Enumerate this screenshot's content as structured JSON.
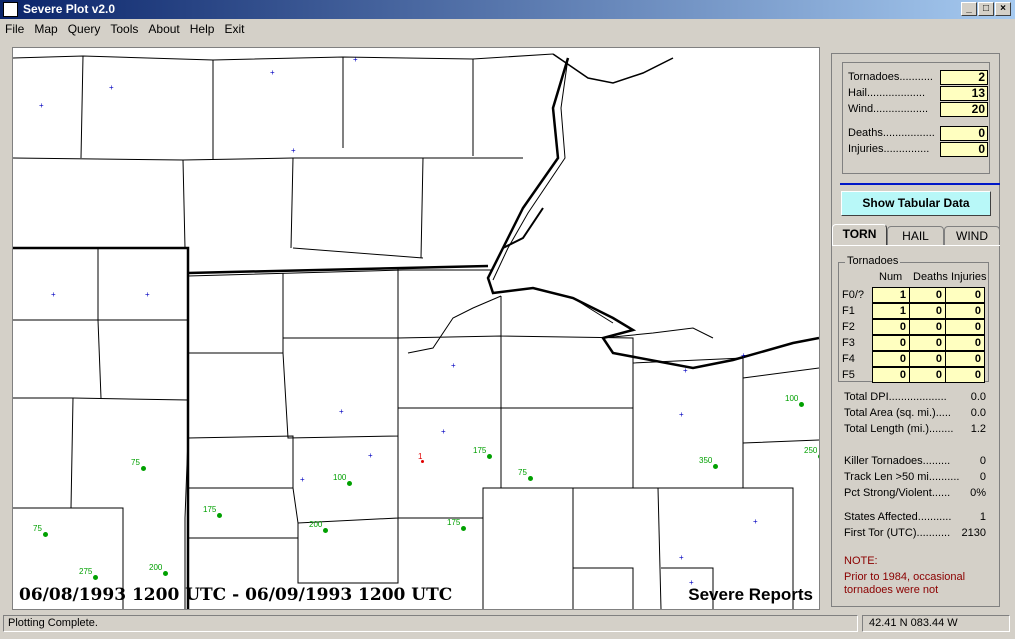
{
  "window": {
    "title": "Severe Plot v2.0"
  },
  "menu": [
    "File",
    "Map",
    "Query",
    "Tools",
    "About",
    "Help",
    "Exit"
  ],
  "map": {
    "date_range": "06/08/1993 1200 UTC - 06/09/1993 1200 UTC",
    "overlay_title": "Severe Reports",
    "reports": [
      {
        "label": "75"
      },
      {
        "label": "100"
      },
      {
        "label": "175"
      },
      {
        "label": "200"
      },
      {
        "label": "75"
      },
      {
        "label": "275"
      },
      {
        "label": "200"
      },
      {
        "label": "175"
      },
      {
        "label": "75"
      },
      {
        "label": "175"
      },
      {
        "label": "350"
      },
      {
        "label": "100"
      },
      {
        "label": "250"
      },
      {
        "label": "1"
      }
    ]
  },
  "summary": {
    "tornadoes_label": "Tornadoes...........",
    "tornadoes": "2",
    "hail_label": "Hail...................",
    "hail": "13",
    "wind_label": "Wind..................",
    "wind": "20",
    "deaths_label": "Deaths.................",
    "deaths": "0",
    "injuries_label": "Injuries...............",
    "injuries": "0"
  },
  "show_tabular_button": "Show Tabular Data",
  "tabs": [
    "TORN",
    "HAIL",
    "WIND"
  ],
  "tornadoes": {
    "group_label": "Tornadoes",
    "headers": [
      "Num",
      "Deaths",
      "Injuries"
    ],
    "rows": [
      {
        "label": "F0/?",
        "num": "1",
        "deaths": "0",
        "injuries": "0"
      },
      {
        "label": "F1",
        "num": "1",
        "deaths": "0",
        "injuries": "0"
      },
      {
        "label": "F2",
        "num": "0",
        "deaths": "0",
        "injuries": "0"
      },
      {
        "label": "F3",
        "num": "0",
        "deaths": "0",
        "injuries": "0"
      },
      {
        "label": "F4",
        "num": "0",
        "deaths": "0",
        "injuries": "0"
      },
      {
        "label": "F5",
        "num": "0",
        "deaths": "0",
        "injuries": "0"
      }
    ]
  },
  "stats": [
    {
      "label": "Total DPI...................",
      "value": "0.0"
    },
    {
      "label": "Total Area (sq. mi.).....",
      "value": "0.0"
    },
    {
      "label": "Total Length (mi.)........",
      "value": "1.2"
    },
    {
      "label": "Killer Tornadoes.........",
      "value": "0"
    },
    {
      "label": "Track Len >50 mi..........",
      "value": "0"
    },
    {
      "label": "Pct Strong/Violent......",
      "value": "0%"
    },
    {
      "label": "States Affected...........",
      "value": "1"
    },
    {
      "label": "First Tor (UTC)...........",
      "value": "2130"
    }
  ],
  "note": {
    "title": "NOTE:",
    "body": "Prior to 1984, occasional tornadoes were not"
  },
  "status": {
    "message": "Plotting Complete.",
    "coords": "42.41 N   083.44 W"
  },
  "colors": {
    "hail": "#00a000",
    "tornado": "#e00000",
    "station": "#0000c0"
  }
}
